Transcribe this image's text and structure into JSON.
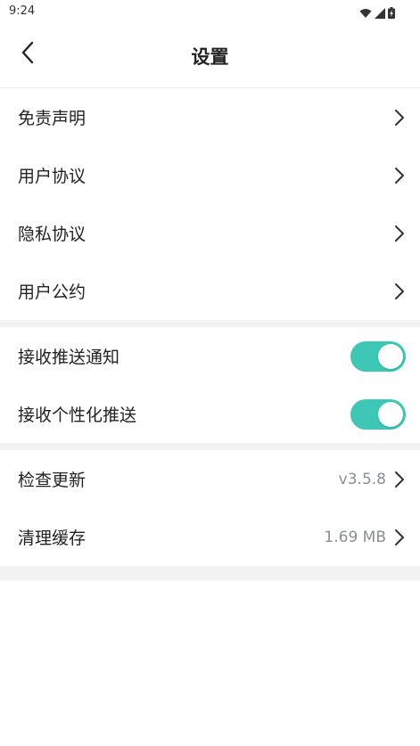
{
  "status_bar": {
    "time": "9:24",
    "icons": [
      "wifi-icon",
      "signal-icon",
      "battery-charging-icon"
    ]
  },
  "header": {
    "title": "设置",
    "back_icon": "chevron-left-icon"
  },
  "sections": {
    "legal": [
      {
        "label": "免责声明"
      },
      {
        "label": "用户协议"
      },
      {
        "label": "隐私协议"
      },
      {
        "label": "用户公约"
      }
    ],
    "notifications": [
      {
        "label": "接收推送通知",
        "enabled": true
      },
      {
        "label": "接收个性化推送",
        "enabled": true
      }
    ],
    "system": [
      {
        "label": "检查更新",
        "value": "v3.5.8"
      },
      {
        "label": "清理缓存",
        "value": "1.69 MB"
      }
    ]
  },
  "colors": {
    "toggle_on": "#3cc8b4",
    "section_gap": "#f3f3f3",
    "value_text": "#8a8f96"
  }
}
